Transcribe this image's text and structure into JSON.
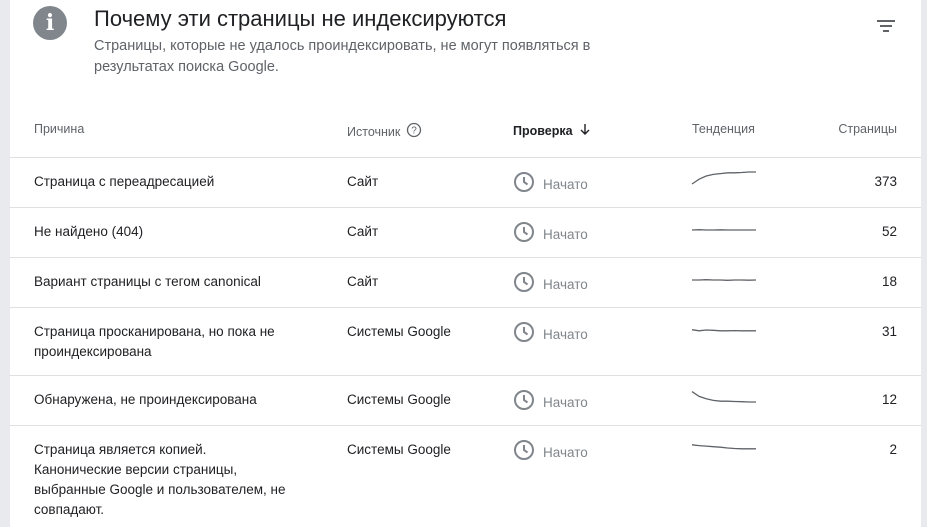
{
  "header": {
    "title": "Почему эти страницы не индексируются",
    "subtitle": "Страницы, которые не удалось проиндексировать, не могут появляться в результатах поиска Google."
  },
  "columns": {
    "reason": "Причина",
    "source": "Источник",
    "check": "Проверка",
    "trend": "Тенденция",
    "pages": "Страницы"
  },
  "rows": [
    {
      "reason": "Страница с переадресацией",
      "source": "Сайт",
      "status": "Начато",
      "pages": "373",
      "trend": [
        0.25,
        0.55,
        0.75,
        0.85,
        0.9,
        0.95,
        0.95,
        0.97,
        1.0,
        1.0
      ]
    },
    {
      "reason": "Не найдено (404)",
      "source": "Сайт",
      "status": "Начато",
      "pages": "52",
      "trend": [
        0.5,
        0.52,
        0.5,
        0.5,
        0.51,
        0.5,
        0.5,
        0.5,
        0.5,
        0.5
      ]
    },
    {
      "reason": "Вариант страницы с тегом canonical",
      "source": "Сайт",
      "status": "Начато",
      "pages": "18",
      "trend": [
        0.5,
        0.5,
        0.52,
        0.5,
        0.5,
        0.48,
        0.5,
        0.5,
        0.49,
        0.5
      ]
    },
    {
      "reason": "Страница просканирована, но пока не проиндексирована",
      "source": "Системы Google",
      "status": "Начато",
      "pages": "31",
      "trend": [
        0.52,
        0.45,
        0.5,
        0.48,
        0.45,
        0.45,
        0.46,
        0.45,
        0.45,
        0.45
      ]
    },
    {
      "reason": "Обнаружена, не проиндексирована",
      "source": "Системы Google",
      "status": "Начато",
      "pages": "12",
      "trend": [
        0.9,
        0.6,
        0.45,
        0.35,
        0.3,
        0.3,
        0.28,
        0.27,
        0.25,
        0.25
      ]
    },
    {
      "reason": "Страница является копией. Канонические версии страницы, выбранные Google и пользователем, не совпадают.",
      "source": "Системы Google",
      "status": "Начато",
      "pages": "2",
      "trend": [
        0.7,
        0.65,
        0.62,
        0.58,
        0.55,
        0.5,
        0.47,
        0.45,
        0.45,
        0.45
      ]
    }
  ],
  "colors": {
    "accent": "#80868b",
    "text": "#202124",
    "muted": "#5f6368",
    "divider": "#e0e0e0"
  }
}
